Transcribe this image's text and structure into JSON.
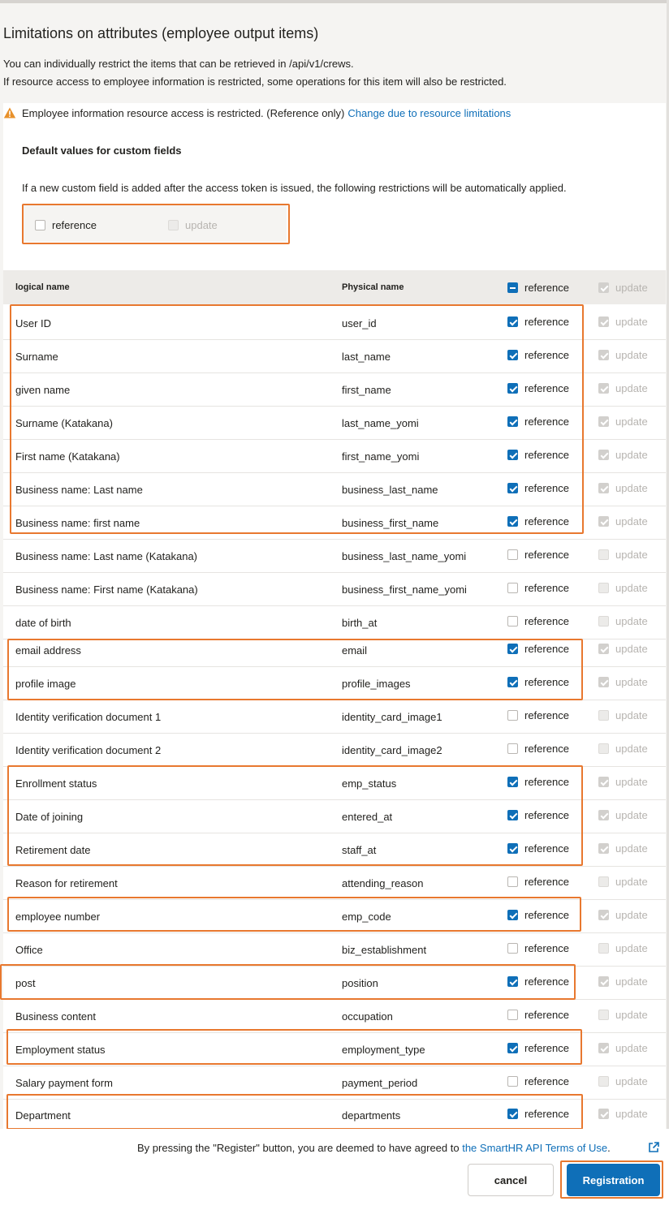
{
  "page": {
    "title": "Limitations on attributes (employee output items)",
    "desc1": "You can individually restrict the items that can be retrieved in /api/v1/crews.",
    "desc2": "If resource access to employee information is restricted, some operations for this item will also be restricted."
  },
  "warning": {
    "icon": "warning-icon",
    "text": "Employee information resource access is restricted. (Reference only)",
    "link": "Change due to resource limitations"
  },
  "defaults": {
    "title": "Default values for custom fields",
    "desc": "If a new custom field is added after the access token is issued, the following restrictions will be automatically applied.",
    "reference_label": "reference",
    "update_label": "update",
    "reference_checked": false,
    "update_checked": false
  },
  "table": {
    "col_logical": "logical name",
    "col_physical": "Physical name",
    "col_reference": "reference",
    "col_update": "update",
    "reference_label": "reference",
    "update_label": "update",
    "rows": [
      {
        "logical": "User ID",
        "physical": "user_id",
        "reference": true
      },
      {
        "logical": "Surname",
        "physical": "last_name",
        "reference": true
      },
      {
        "logical": "given name",
        "physical": "first_name",
        "reference": true
      },
      {
        "logical": "Surname (Katakana)",
        "physical": "last_name_yomi",
        "reference": true
      },
      {
        "logical": "First name (Katakana)",
        "physical": "first_name_yomi",
        "reference": true
      },
      {
        "logical": "Business name: Last name",
        "physical": "business_last_name",
        "reference": true
      },
      {
        "logical": "Business name: first name",
        "physical": "business_first_name",
        "reference": true
      },
      {
        "logical": "Business name: Last name (Katakana)",
        "physical": "business_last_name_yomi",
        "reference": false
      },
      {
        "logical": "Business name: First name (Katakana)",
        "physical": "business_first_name_yomi",
        "reference": false
      },
      {
        "logical": "date of birth",
        "physical": "birth_at",
        "reference": false
      },
      {
        "logical": "email address",
        "physical": "email",
        "reference": true
      },
      {
        "logical": "profile image",
        "physical": "profile_images",
        "reference": true
      },
      {
        "logical": "Identity verification document 1",
        "physical": "identity_card_image1",
        "reference": false
      },
      {
        "logical": "Identity verification document 2",
        "physical": "identity_card_image2",
        "reference": false
      },
      {
        "logical": "Enrollment status",
        "physical": "emp_status",
        "reference": true
      },
      {
        "logical": "Date of joining",
        "physical": "entered_at",
        "reference": true
      },
      {
        "logical": "Retirement date",
        "physical": "staff_at",
        "reference": true
      },
      {
        "logical": "Reason for retirement",
        "physical": "attending_reason",
        "reference": false
      },
      {
        "logical": "employee number",
        "physical": "emp_code",
        "reference": true
      },
      {
        "logical": "Office",
        "physical": "biz_establishment",
        "reference": false
      },
      {
        "logical": "post",
        "physical": "position",
        "reference": true
      },
      {
        "logical": "Business content",
        "physical": "occupation",
        "reference": false
      },
      {
        "logical": "Employment status",
        "physical": "employment_type",
        "reference": true
      },
      {
        "logical": "Salary payment form",
        "physical": "payment_period",
        "reference": false
      },
      {
        "logical": "Department",
        "physical": "departments",
        "reference": true
      }
    ]
  },
  "footer": {
    "agree_prefix": "By pressing the \"Register\" button, you are deemed to have agreed to",
    "agree_link": "the SmartHR API Terms of Use",
    "agree_suffix": ".",
    "cancel_label": "cancel",
    "register_label": "Registration"
  },
  "colors": {
    "accent": "#0f6fb8",
    "highlight": "#e8782f",
    "warning": "#e8912b"
  }
}
